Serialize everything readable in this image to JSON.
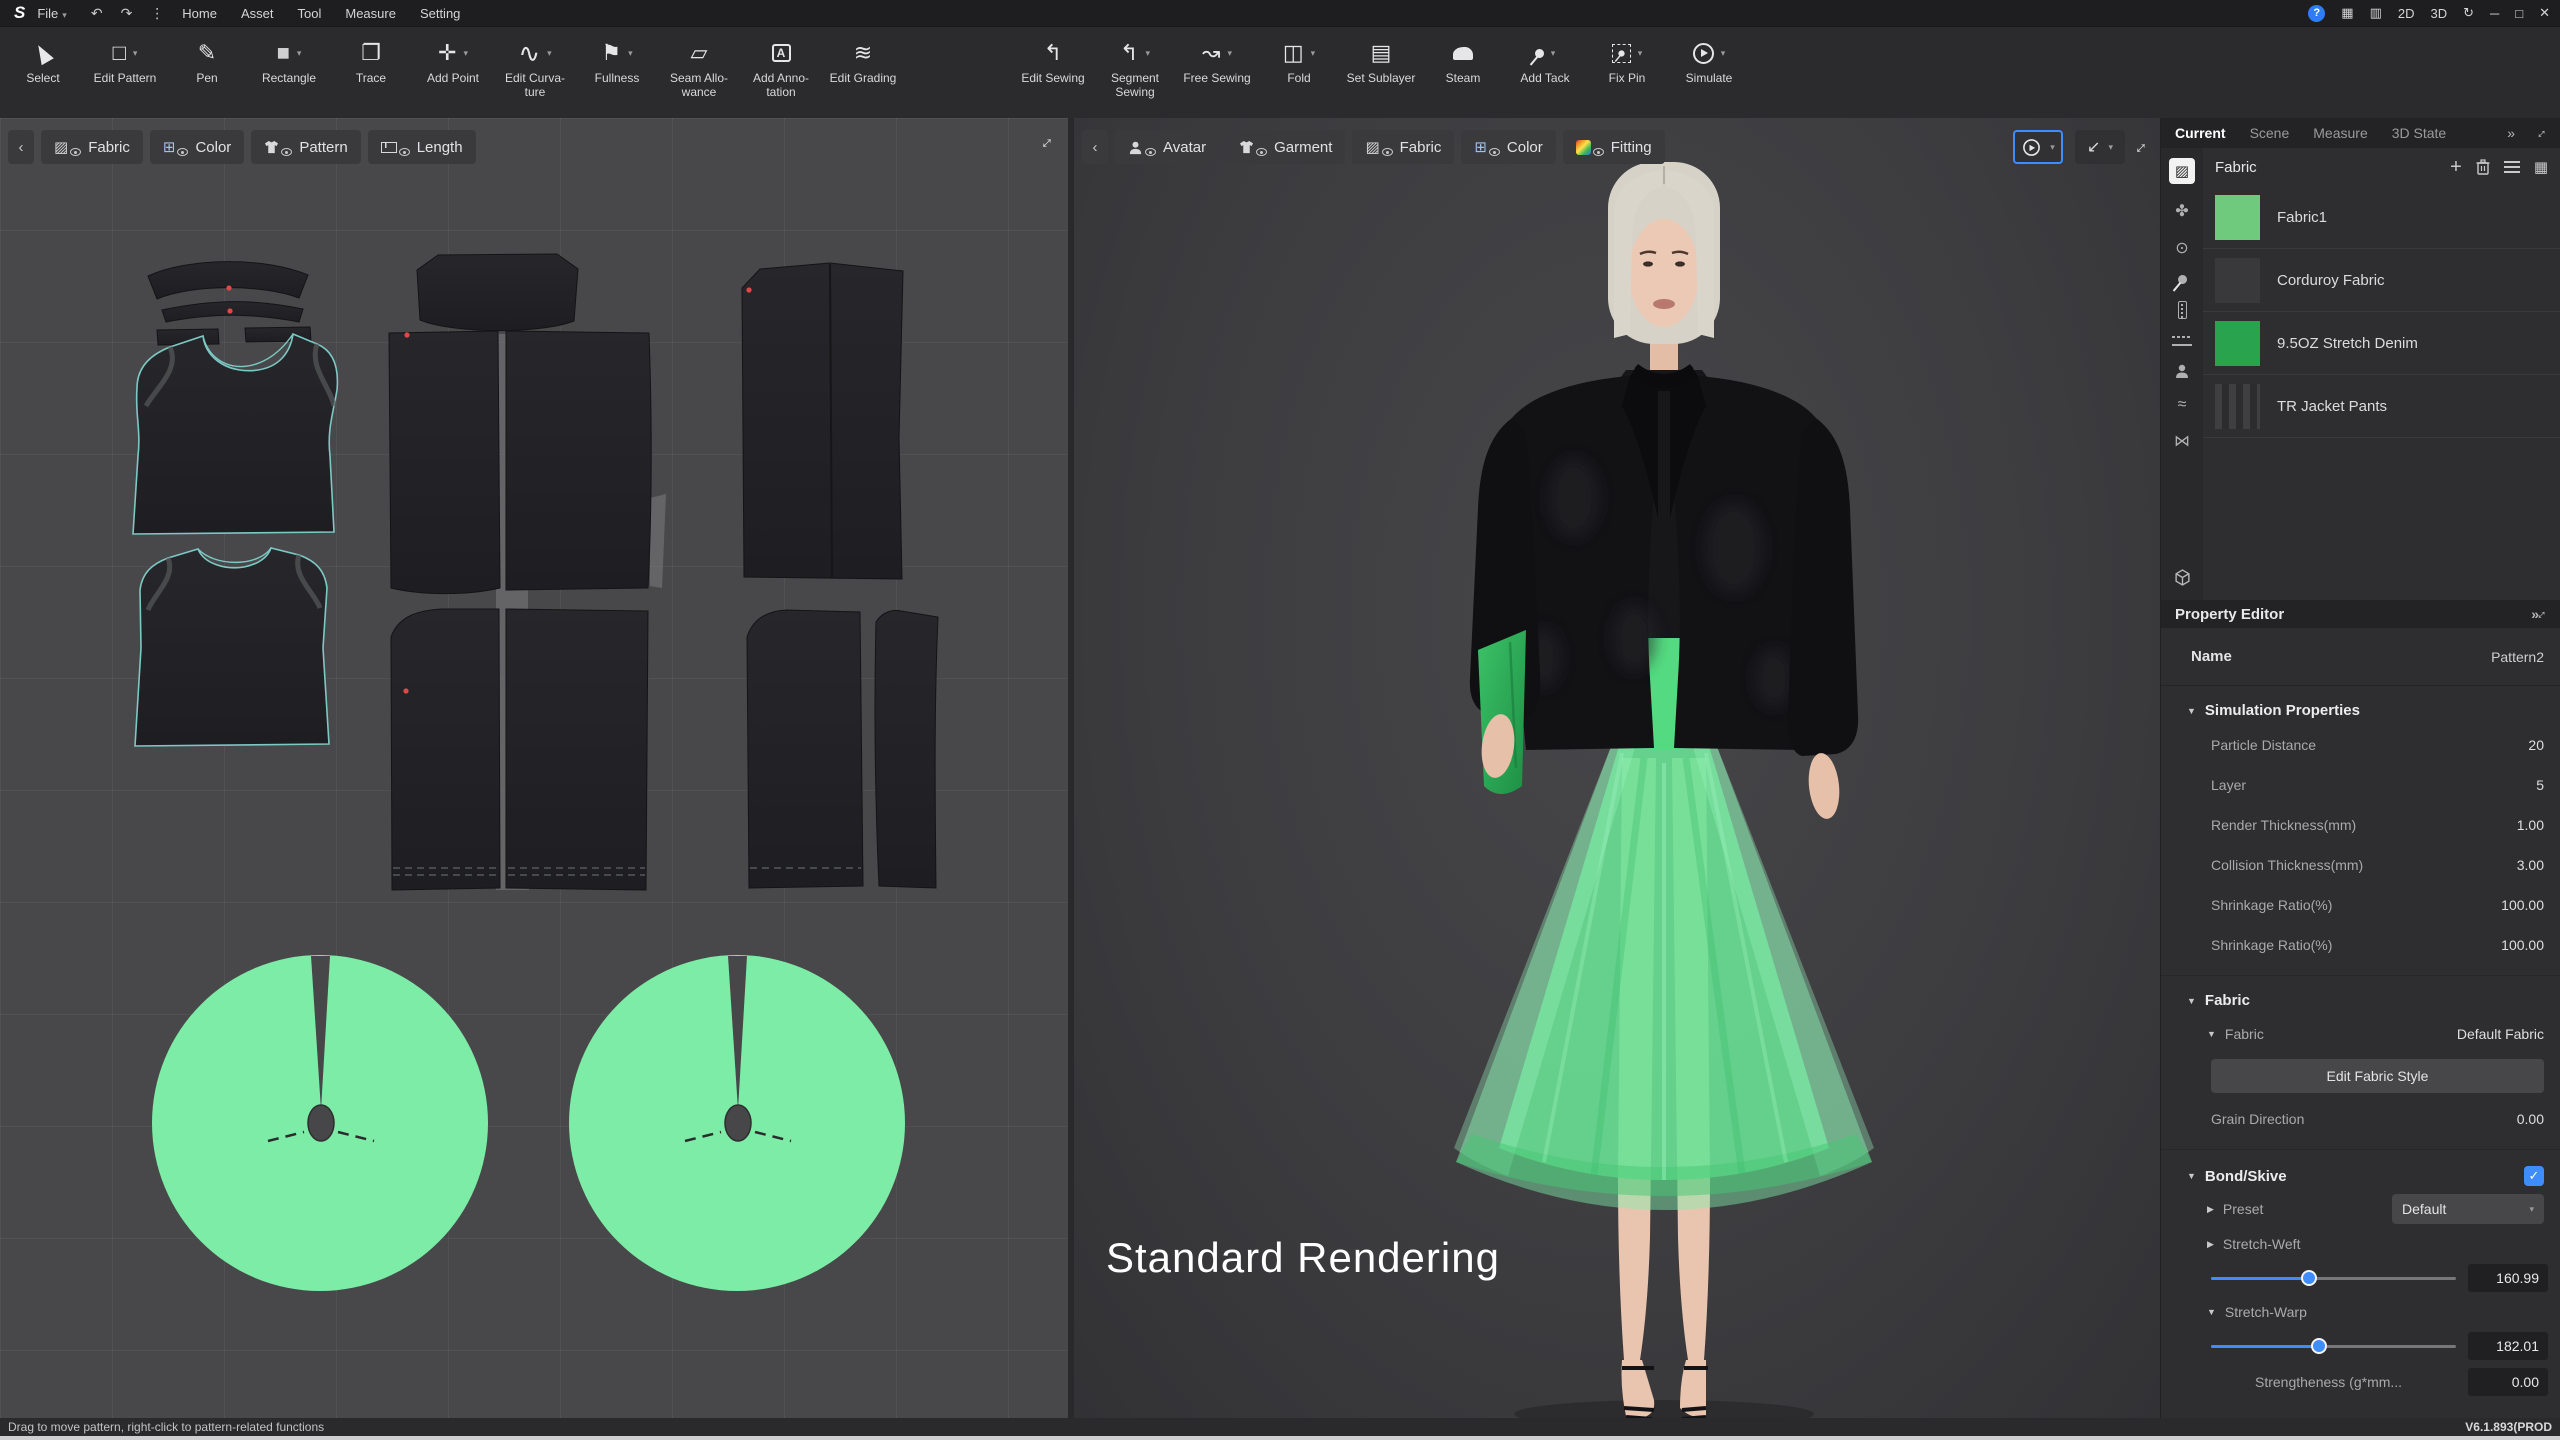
{
  "app": {
    "logo": "S"
  },
  "menu": {
    "file": "File",
    "items": [
      "Home",
      "Asset",
      "Tool",
      "Measure",
      "Setting"
    ]
  },
  "window_controls": {
    "mode_2d": "2D",
    "mode_3d": "3D"
  },
  "toolbar": {
    "buttons": [
      {
        "label": "Select"
      },
      {
        "label": "Edit Pattern"
      },
      {
        "label": "Pen"
      },
      {
        "label": "Rectangle"
      },
      {
        "label": "Trace"
      },
      {
        "label": "Add Point"
      },
      {
        "label": "Edit Curva-ture"
      },
      {
        "label": "Fullness"
      },
      {
        "label": "Seam Allo-wance"
      },
      {
        "label": "Add Anno-tation"
      },
      {
        "label": "Edit Grading"
      },
      {
        "label": "Edit Sewing"
      },
      {
        "label": "Segment Sewing"
      },
      {
        "label": "Free Sewing"
      },
      {
        "label": "Fold"
      },
      {
        "label": "Set Sublayer"
      },
      {
        "label": "Steam"
      },
      {
        "label": "Add Tack"
      },
      {
        "label": "Fix Pin"
      },
      {
        "label": "Simulate"
      }
    ]
  },
  "panel2d": {
    "tabs": [
      {
        "label": "Fabric"
      },
      {
        "label": "Color"
      },
      {
        "label": "Pattern"
      },
      {
        "label": "Length"
      }
    ]
  },
  "panel3d": {
    "tabs": [
      {
        "label": "Avatar"
      },
      {
        "label": "Garment"
      },
      {
        "label": "Fabric"
      },
      {
        "label": "Color"
      },
      {
        "label": "Fitting"
      }
    ],
    "render_mode": "Standard Rendering"
  },
  "right_panel": {
    "tabs": [
      {
        "label": "Current"
      },
      {
        "label": "Scene"
      },
      {
        "label": "Measure"
      },
      {
        "label": "3D State"
      }
    ],
    "fabric_browser": {
      "title": "Fabric",
      "items": [
        {
          "name": "Fabric1",
          "swatch_color": "#6fca7d"
        },
        {
          "name": "Corduroy Fabric",
          "swatch_color": "#39393c"
        },
        {
          "name": "9.5OZ Stretch Denim",
          "swatch_color": "#2aa34f"
        },
        {
          "name": "TR Jacket Pants",
          "swatch_color": "#3a3a3d"
        }
      ]
    },
    "property_editor": {
      "title": "Property Editor",
      "name_label": "Name",
      "name_value": "Pattern2",
      "simulation": {
        "title": "Simulation Properties",
        "rows": [
          {
            "label": "Particle Distance",
            "value": "20"
          },
          {
            "label": "Layer",
            "value": "5"
          },
          {
            "label": "Render Thickness(mm)",
            "value": "1.00"
          },
          {
            "label": "Collision Thickness(mm)",
            "value": "3.00"
          },
          {
            "label": "Shrinkage Ratio(%)",
            "value": "100.00"
          },
          {
            "label": "Shrinkage Ratio(%)",
            "value": "100.00"
          }
        ]
      },
      "fabric": {
        "title": "Fabric",
        "sub_label": "Fabric",
        "sub_value": "Default Fabric",
        "edit_button": "Edit Fabric Style",
        "grain_label": "Grain Direction",
        "grain_value": "0.00"
      },
      "bond": {
        "title": "Bond/Skive",
        "preset_label": "Preset",
        "preset_value": "Default",
        "weft_label": "Stretch-Weft",
        "weft_value": "160.99",
        "warp_label": "Stretch-Warp",
        "warp_value": "182.01",
        "strength_label": "Strengtheness (g*mm...",
        "strength_value": "0.00"
      }
    }
  },
  "status_bar": {
    "hint": "Drag to move pattern, right-click to pattern-related functions",
    "version": "V6.1.893(PROD"
  },
  "colors": {
    "accent_blue": "#3f8cfd",
    "pattern_circle_green": "#7deca6",
    "fabric1_green": "#6fca7d",
    "denim_green": "#2aa34f",
    "skirt_green": "#50d67e"
  }
}
